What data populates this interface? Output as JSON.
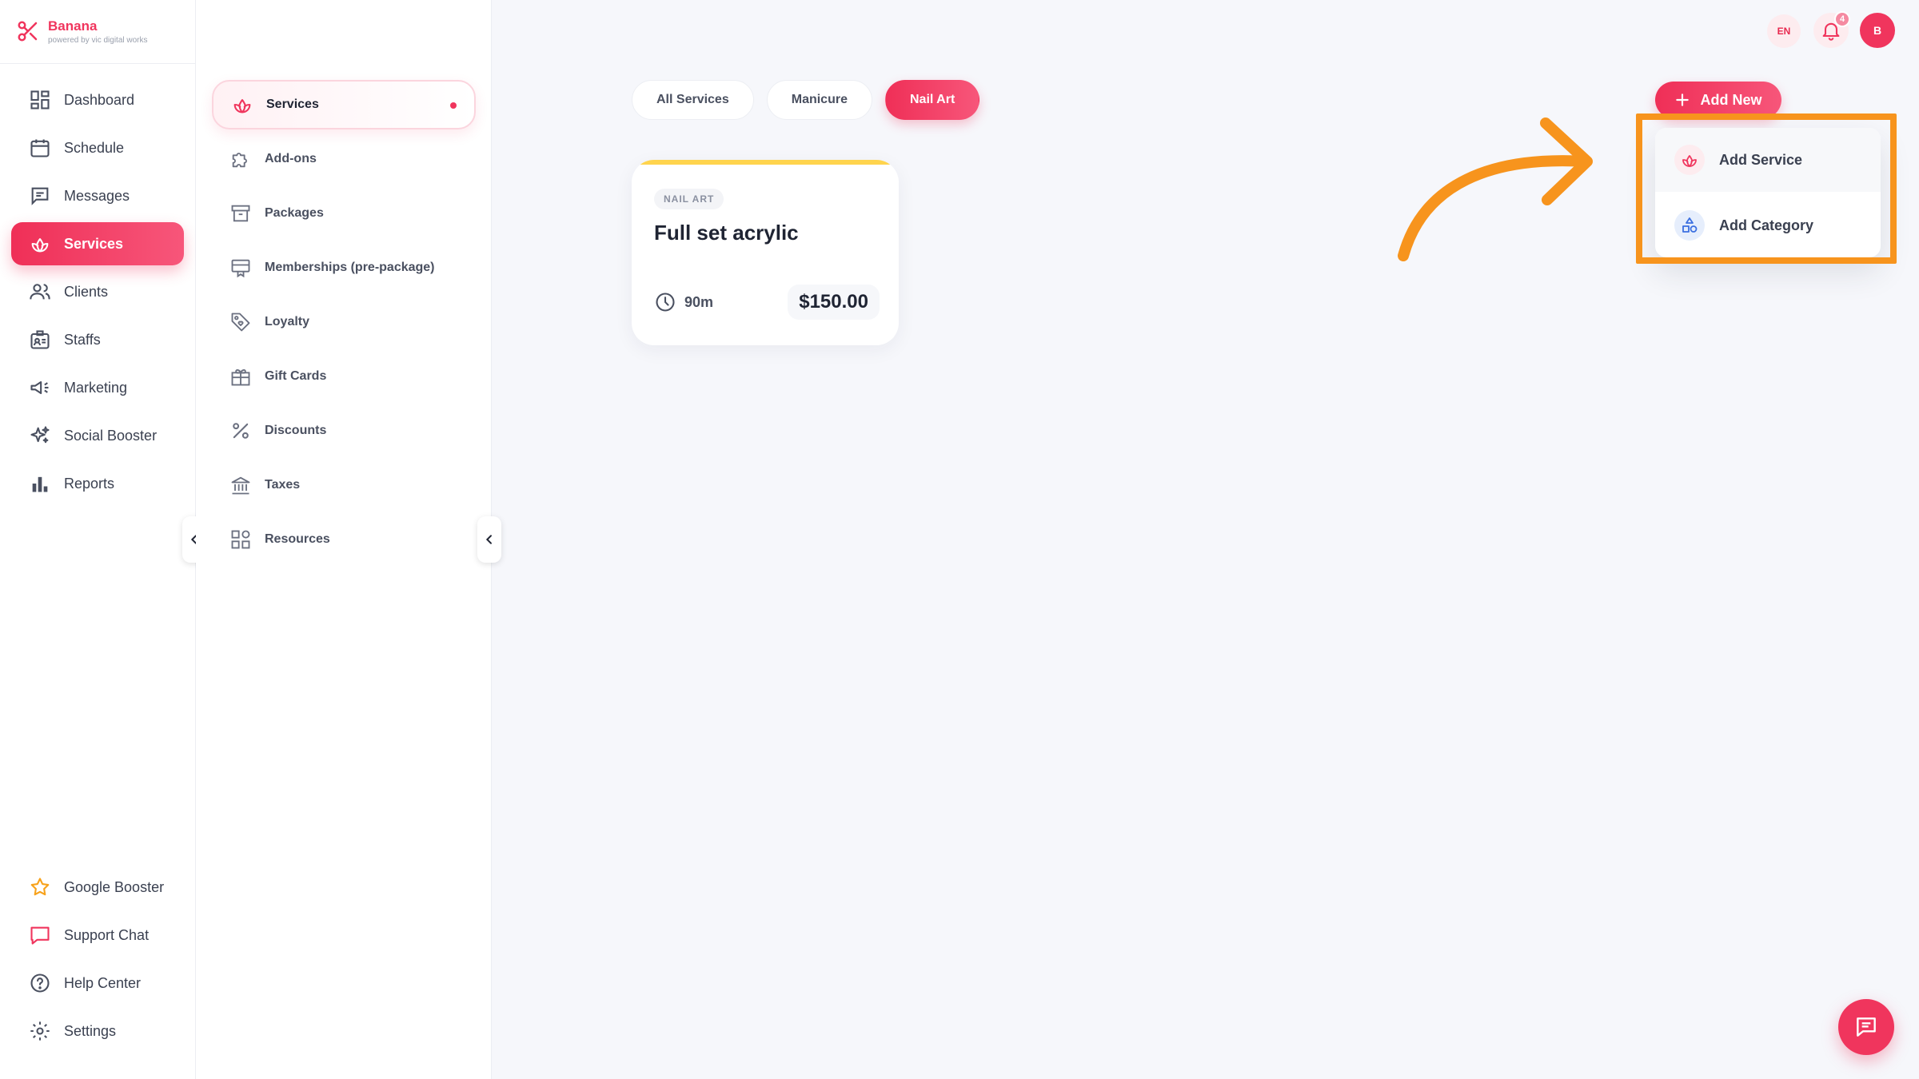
{
  "brand": {
    "name": "Banana",
    "tagline": "powered by vic digital works",
    "color": "#f0355d"
  },
  "sidebar": {
    "items": [
      {
        "label": "Dashboard",
        "icon": "dashboard-icon"
      },
      {
        "label": "Schedule",
        "icon": "calendar-icon"
      },
      {
        "label": "Messages",
        "icon": "message-icon"
      },
      {
        "label": "Services",
        "icon": "lotus-icon",
        "active": true
      },
      {
        "label": "Clients",
        "icon": "users-icon"
      },
      {
        "label": "Staffs",
        "icon": "id-badge-icon"
      },
      {
        "label": "Marketing",
        "icon": "megaphone-icon"
      },
      {
        "label": "Social Booster",
        "icon": "sparkle-icon"
      },
      {
        "label": "Reports",
        "icon": "bar-chart-icon"
      }
    ],
    "bottom_items": [
      {
        "label": "Google Booster",
        "icon": "star-icon"
      },
      {
        "label": "Support Chat",
        "icon": "chat-bubble-icon"
      },
      {
        "label": "Help Center",
        "icon": "help-icon"
      },
      {
        "label": "Settings",
        "icon": "gear-icon"
      }
    ]
  },
  "subnav": {
    "items": [
      {
        "label": "Services",
        "icon": "lotus-icon",
        "active": true
      },
      {
        "label": "Add-ons",
        "icon": "puzzle-icon"
      },
      {
        "label": "Packages",
        "icon": "archive-icon"
      },
      {
        "label": "Memberships (pre-package)",
        "icon": "membership-icon"
      },
      {
        "label": "Loyalty",
        "icon": "tag-icon"
      },
      {
        "label": "Gift Cards",
        "icon": "gift-icon"
      },
      {
        "label": "Discounts",
        "icon": "percent-icon"
      },
      {
        "label": "Taxes",
        "icon": "bank-icon"
      },
      {
        "label": "Resources",
        "icon": "grid-icon"
      }
    ]
  },
  "topbar": {
    "language": "EN",
    "notification_count": "4",
    "avatar_initial": "B"
  },
  "filters": {
    "chips": [
      {
        "label": "All Services",
        "active": false
      },
      {
        "label": "Manicure",
        "active": false
      },
      {
        "label": "Nail Art",
        "active": true
      }
    ]
  },
  "service_card": {
    "category": "NAIL ART",
    "title": "Full set acrylic",
    "duration": "90m",
    "price": "$150.00",
    "accent_color": "#ffd44d"
  },
  "add_new": {
    "label": "Add New",
    "menu": [
      {
        "label": "Add Service",
        "icon": "lotus-icon"
      },
      {
        "label": "Add Category",
        "icon": "shapes-icon"
      }
    ]
  },
  "annotation": {
    "highlight_color": "#f7941d"
  }
}
